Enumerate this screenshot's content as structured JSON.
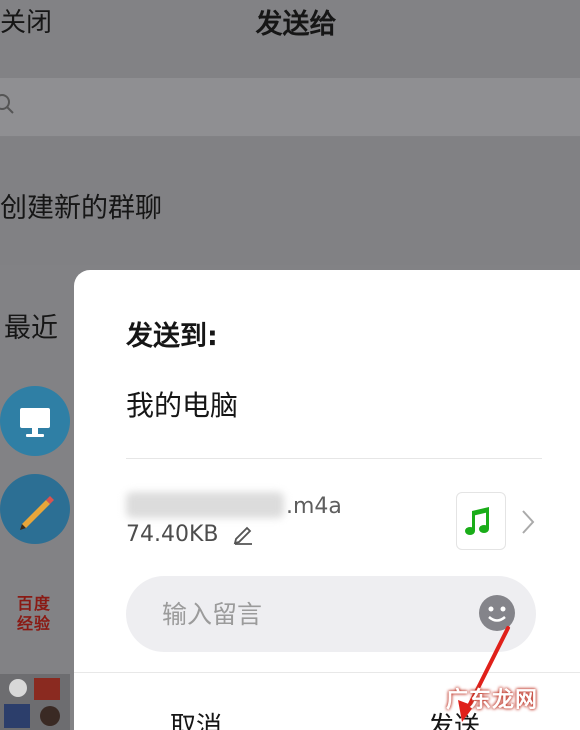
{
  "topbar": {
    "close_label": "关闭",
    "title": "发送给"
  },
  "search": {
    "placeholder": ""
  },
  "new_group": {
    "label": "创建新的群聊"
  },
  "recent": {
    "label": "最近",
    "avatars": [
      {
        "icon": "computer-icon"
      },
      {
        "icon": "pencil-icon"
      },
      {
        "text": "百度经验"
      },
      {
        "icon": "group-avatar"
      }
    ]
  },
  "dialog": {
    "title": "发送到:",
    "recipient": "我的电脑",
    "file": {
      "ext": ".m4a",
      "size": "74.40KB",
      "thumb_icon": "music-note-icon"
    },
    "message": {
      "placeholder": "输入留言"
    },
    "buttons": {
      "cancel": "取消",
      "send": "发送"
    }
  },
  "watermark": {
    "text": "广东龙网"
  },
  "colors": {
    "music_green": "#1aad19",
    "annotation_red": "#e0201a",
    "overlay": "#828285"
  }
}
